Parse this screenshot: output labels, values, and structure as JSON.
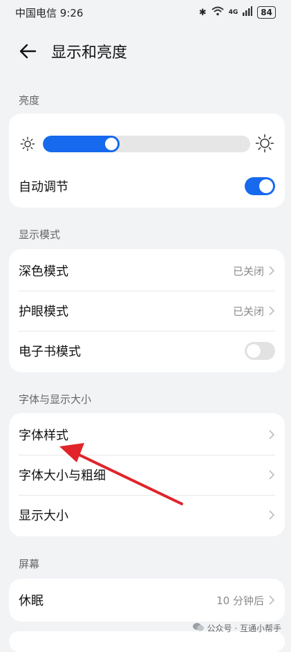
{
  "status": {
    "carrier_time": "中国电信 9:26",
    "battery": "84",
    "network": "4G"
  },
  "header": {
    "title": "显示和亮度"
  },
  "brightness": {
    "section_label": "亮度",
    "level": 0.37,
    "auto_label": "自动调节",
    "auto_on": true
  },
  "display_mode": {
    "section_label": "显示模式",
    "dark_label": "深色模式",
    "dark_value": "已关闭",
    "eye_label": "护眼模式",
    "eye_value": "已关闭",
    "ebook_label": "电子书模式",
    "ebook_on": false
  },
  "font": {
    "section_label": "字体与显示大小",
    "style_label": "字体样式",
    "size_label": "字体大小与粗细",
    "display_size_label": "显示大小"
  },
  "screen": {
    "section_label": "屏幕",
    "sleep_label": "休眠",
    "sleep_value": "10 分钟后"
  },
  "watermark": {
    "text": "公众号 · 互通小帮手"
  },
  "colors": {
    "accent": "#1769ee",
    "arrow": "#e0242a"
  }
}
